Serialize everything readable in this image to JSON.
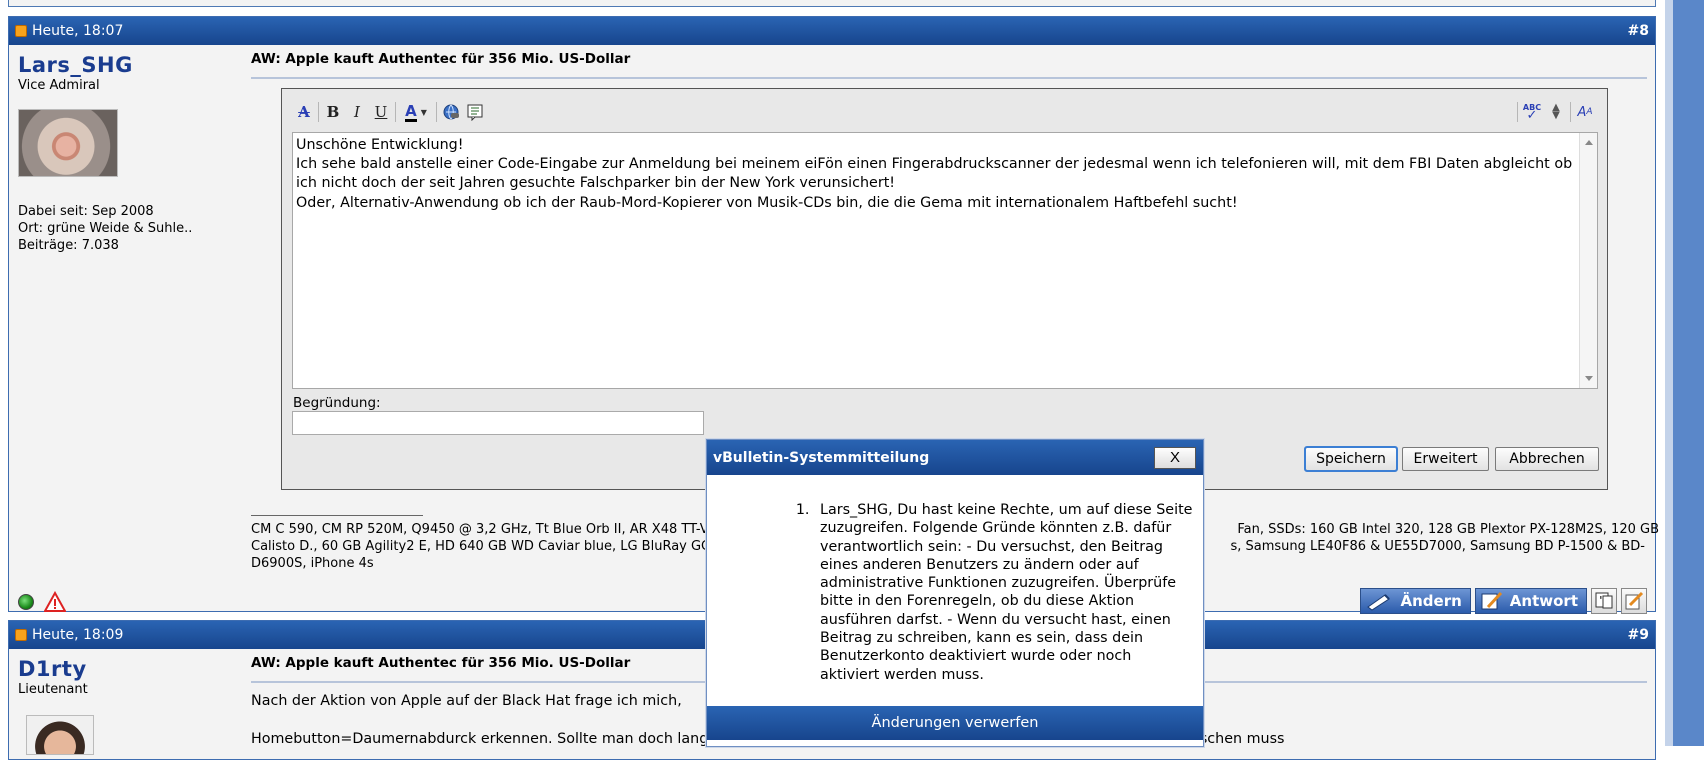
{
  "post8": {
    "date": "Heute, 18:07",
    "number": "#8",
    "username": "Lars_SHG",
    "usertitle": "Vice Admiral",
    "joined": "Dabei seit: Sep 2008",
    "location": "Ort: grüne Weide & Suhle..",
    "posts": "Beiträge: 7.038",
    "title": "AW: Apple kauft Authentec für 356 Mio. US-Dollar",
    "editor_text": [
      "Unschöne Entwicklung!",
      "Ich sehe bald anstelle einer Code-Eingabe zur Anmeldung bei meinem eiFön einen Fingerabdruckscanner der jedesmal wenn ich telefonieren will, mit dem FBI Daten abgleicht ob ich nicht doch der seit Jahren gesuchte Falschparker bin der New York verunsichert!",
      "Oder, Alternativ-Anwendung ob ich der Raub-Mord-Kopierer von Musik-CDs bin, die die Gema mit internationalem Haftbefehl sucht!"
    ],
    "reason_label": "Begründung:",
    "reason_value": "",
    "buttons": {
      "save": "Speichern",
      "advanced": "Erweitert",
      "cancel": "Abbrechen"
    },
    "signature_left": "CM C 590, CM RP 520M, Q9450 @ 3,2 GHz, Tt Blue Orb II, AR X48 TT-V",
    "signature_right_1": "Fan, SSDs: 160 GB Intel 320, 128 GB Plextor PX-128M2S, 120 GB",
    "signature_left_2": "Calisto D., 60 GB Agility2 E, HD 640 GB WD Caviar blue, LG BluRay GG",
    "signature_right_2": "s, Samsung LE40F86 & UE55D7000, Samsung BD P-1500 & BD-",
    "signature_line_3": "D6900S, iPhone 4s",
    "action_edit": "Ändern",
    "action_reply": "Antwort"
  },
  "post9": {
    "date": "Heute, 18:09",
    "number": "#9",
    "username": "D1rty",
    "usertitle": "Lieutenant",
    "title": "AW: Apple kauft Authentec für 356 Mio. US-Dollar",
    "line1": "Nach der Aktion von Apple auf der Black Hat frage ich mich,",
    "line2": "Homebutton=Daumernabdurck erkennen. Sollte man doch langsam hinbekommen. dass man nicht mehr über den Sensor hinwegwischen muss"
  },
  "dialog": {
    "title": "vBulletin-Systemmitteilung",
    "close": "X",
    "message": "Lars_SHG, Du hast keine Rechte, um auf diese Seite zuzugreifen. Folgende Gründe könnten z.B. dafür verantwortlich sein: - Du versuchst, den Beitrag eines anderen Benutzers zu ändern oder auf administrative Funktionen zuzugreifen. Überprüfe bitte in den Forenregeln, ob du diese Aktion ausführen darfst. - Wenn du versucht hast, einen Beitrag zu schreiben, kann es sein, dass dein Benutzerkonto deaktiviert wurde oder noch aktiviert werden muss.",
    "footer": "Änderungen verwerfen"
  },
  "colors": {
    "header_blue": "#17458d",
    "username_blue": "#1a3c8f",
    "post_bg": "#f3f3f3",
    "sidebar_blue": "#5a87c9"
  },
  "icons": [
    "post-status-icon",
    "remove-format-icon",
    "bold-icon",
    "italic-icon",
    "underline-icon",
    "font-color-icon",
    "link-icon",
    "quote-icon",
    "spellcheck-icon",
    "resize-icon",
    "switch-editor-icon",
    "online-status-icon",
    "report-icon",
    "edit-icon",
    "reply-icon",
    "multiquote-icon",
    "quick-reply-icon"
  ]
}
